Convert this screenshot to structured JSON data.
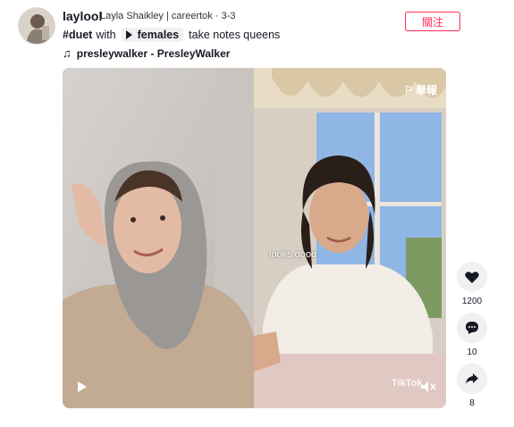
{
  "author": {
    "username": "laylool",
    "nickname": "Layla Shaikley",
    "category": "careertok",
    "date": "3-3"
  },
  "follow_label": "關注",
  "caption": {
    "prefix": "#duet",
    "with_word": "with",
    "tag": "females",
    "suffix": "take notes queens"
  },
  "music": "presleywalker - PresleyWalker",
  "video": {
    "report_label": "舉報",
    "overlay_caption": "looks good",
    "watermark": "TikTok"
  },
  "actions": {
    "likes": "1200",
    "comments": "10",
    "shares": "8"
  },
  "colors": {
    "accent": "#fe2c55",
    "button_bg": "#f1f1f2"
  }
}
